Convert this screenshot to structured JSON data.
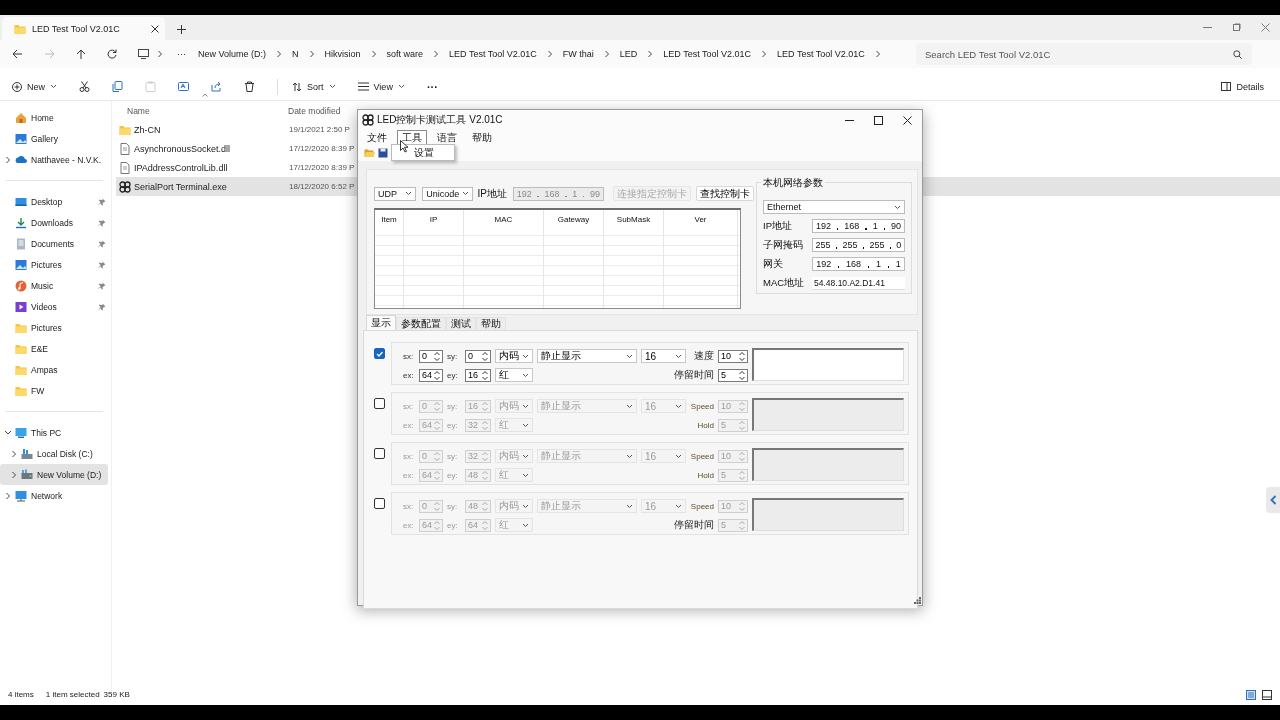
{
  "tab": {
    "title": "LED Test Tool V2.01C"
  },
  "breadcrumb": [
    "New Volume (D:)",
    "N",
    "Hikvision",
    "soft ware",
    "LED Test Tool V2.01C",
    "FW thai",
    "LED",
    "LED Test Tool V2.01C",
    "LED Test Tool V2.01C"
  ],
  "overflow_crumb": "···",
  "search": {
    "placeholder": "Search LED Test Tool V2.01C"
  },
  "toolbar": {
    "new": "New",
    "sort": "Sort",
    "view": "View",
    "more": "···",
    "details": "Details"
  },
  "sidebar": {
    "groups": [
      {
        "items": [
          {
            "label": "Home",
            "kind": "home",
            "selected": false
          },
          {
            "label": "Gallery",
            "kind": "gallery",
            "selected": false
          },
          {
            "label": "Natthavee - N.V.K.",
            "kind": "cloud",
            "selected": false,
            "expanded": false
          }
        ]
      },
      {
        "items": [
          {
            "label": "Desktop",
            "kind": "desktop",
            "selected": false,
            "pinned": true
          },
          {
            "label": "Downloads",
            "kind": "download",
            "selected": false,
            "pinned": true
          },
          {
            "label": "Documents",
            "kind": "document",
            "selected": false,
            "pinned": true
          },
          {
            "label": "Pictures",
            "kind": "pictures",
            "selected": false,
            "pinned": true
          },
          {
            "label": "Music",
            "kind": "music",
            "selected": false,
            "pinned": true
          },
          {
            "label": "Videos",
            "kind": "videos",
            "selected": false,
            "pinned": true
          },
          {
            "label": "Pictures",
            "kind": "folder",
            "selected": false,
            "pinned": false
          },
          {
            "label": "E&E",
            "kind": "folder",
            "selected": false,
            "pinned": false
          },
          {
            "label": "Ampas",
            "kind": "folder",
            "selected": false,
            "pinned": false
          },
          {
            "label": "FW",
            "kind": "folder",
            "selected": false,
            "pinned": false
          }
        ]
      },
      {
        "items": [
          {
            "label": "This PC",
            "kind": "pc",
            "selected": false,
            "expanded": true,
            "children": [
              {
                "label": "Local Disk (C:)",
                "kind": "disk",
                "selected": false,
                "expanded": false
              },
              {
                "label": "New Volume (D:)",
                "kind": "drive",
                "selected": true,
                "expanded": false
              }
            ]
          },
          {
            "label": "Network",
            "kind": "network",
            "selected": false,
            "expanded": false
          }
        ]
      }
    ]
  },
  "files": {
    "columns": [
      "Name",
      "Date modified"
    ],
    "rows": [
      {
        "name": "Zh-CN",
        "date": "19/1/2021 2:50 P",
        "kind": "folder",
        "selected": false
      },
      {
        "name": "AsynchronousSocket.dll",
        "date": "17/12/2020 8:39 P",
        "kind": "dll",
        "selected": false
      },
      {
        "name": "IPAddressControlLib.dll",
        "date": "17/12/2020 8:39 P",
        "kind": "dll",
        "selected": false
      },
      {
        "name": "SerialPort Terminal.exe",
        "date": "18/12/2020 6:52 P",
        "kind": "exe",
        "selected": true
      }
    ]
  },
  "status_bar": {
    "count": "4 items",
    "selection": "1 item selected",
    "size": "359 KB"
  },
  "dialog": {
    "title": "LED控制卡测试工具 V2.01C",
    "menu": [
      {
        "label": "文件",
        "selected": false
      },
      {
        "label": "工具",
        "selected": true
      },
      {
        "label": "语言",
        "selected": false
      },
      {
        "label": "帮助",
        "selected": false
      }
    ],
    "open_menu": [
      "设置"
    ],
    "connection": {
      "protocol": "UDP",
      "encoding": "Unicode",
      "ip_label": "IP地址",
      "ip": [
        "192",
        "168",
        "1",
        "99"
      ],
      "connect_button": {
        "label": "连接指定控制卡",
        "disabled": true
      },
      "find_button": {
        "label": "查找控制卡",
        "disabled": false
      }
    },
    "device_table": {
      "columns": [
        "Item",
        "IP",
        "MAC",
        "Gateway",
        "SubMask",
        "Ver"
      ]
    },
    "network": {
      "title": "本机网络参数",
      "adapter": "Ethernet",
      "fields": [
        {
          "label": "IP地址",
          "octets": [
            "192",
            "168",
            "1",
            "90"
          ]
        },
        {
          "label": "子网掩码",
          "octets": [
            "255",
            "255",
            "255",
            "0"
          ]
        },
        {
          "label": "网关",
          "octets": [
            "192",
            "168",
            "1",
            "1"
          ]
        }
      ],
      "mac_label": "MAC地址",
      "mac": "54.48.10.A2.D1.41"
    },
    "tabs": [
      {
        "label": "显示",
        "selected": true
      },
      {
        "label": "参数配置",
        "selected": false
      },
      {
        "label": "测试",
        "selected": false
      },
      {
        "label": "帮助",
        "selected": false
      }
    ],
    "areas": [
      {
        "checked": true,
        "coords": [
          {
            "label": "sx:",
            "value": "0"
          },
          {
            "label": "sy:",
            "value": "0"
          },
          {
            "label": "ex:",
            "value": "64"
          },
          {
            "label": "ey:",
            "value": "16"
          }
        ],
        "code": "内码",
        "effect": "静止显示",
        "size": "16",
        "led_color_option": "红",
        "speed_label": "速度",
        "speed": "10",
        "hold_label": "停留时间",
        "hold": "5"
      },
      {
        "checked": false,
        "coords": [
          {
            "label": "sx:",
            "value": "0"
          },
          {
            "label": "sy:",
            "value": "16"
          },
          {
            "label": "ex:",
            "value": "64"
          },
          {
            "label": "ey:",
            "value": "32"
          }
        ],
        "code": "内码",
        "effect": "静止显示",
        "size": "16",
        "led_color_option": "红",
        "speed_label": "Speed",
        "speed": "10",
        "hold_label": "Hold",
        "hold": "5"
      },
      {
        "checked": false,
        "coords": [
          {
            "label": "sx:",
            "value": "0"
          },
          {
            "label": "sy:",
            "value": "32"
          },
          {
            "label": "ex:",
            "value": "64"
          },
          {
            "label": "ey:",
            "value": "48"
          }
        ],
        "code": "内码",
        "effect": "静止显示",
        "size": "16",
        "led_color_option": "红",
        "speed_label": "Speed",
        "speed": "10",
        "hold_label": "Hold",
        "hold": "5"
      },
      {
        "checked": false,
        "coords": [
          {
            "label": "sx:",
            "value": "0"
          },
          {
            "label": "sy:",
            "value": "48"
          },
          {
            "label": "ex:",
            "value": "64"
          },
          {
            "label": "ey:",
            "value": "64"
          }
        ],
        "code": "内码",
        "effect": "静止显示",
        "size": "16",
        "led_color_option": "红",
        "speed_label": "Speed",
        "speed": "10",
        "hold_label": "停留时间",
        "hold": "5"
      }
    ]
  }
}
